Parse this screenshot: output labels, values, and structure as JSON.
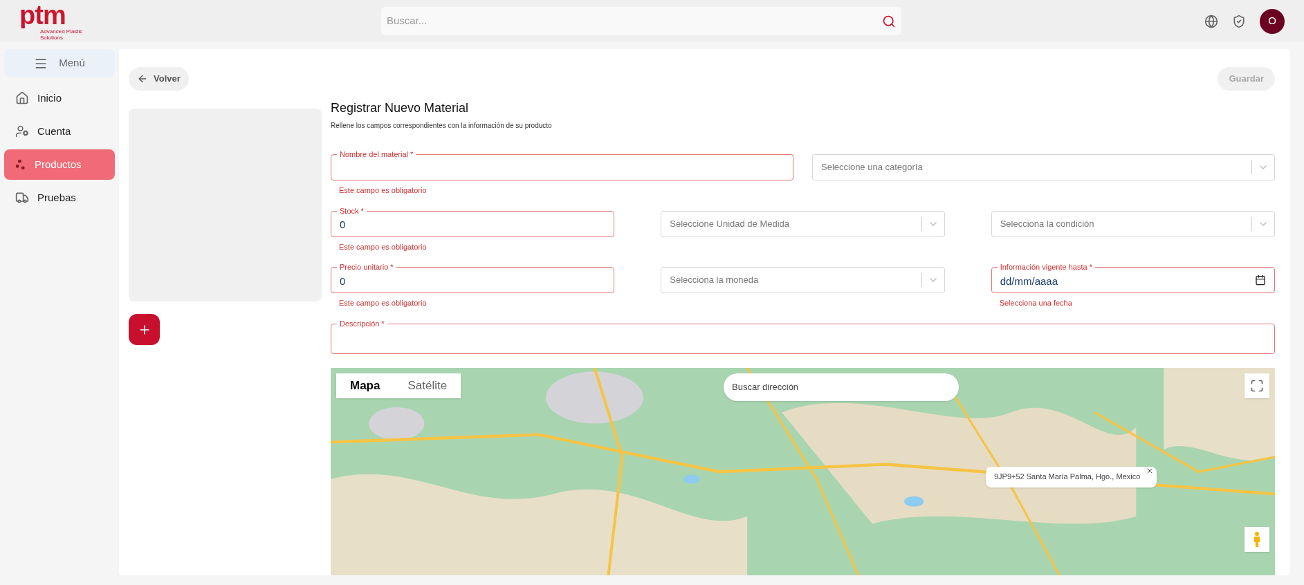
{
  "header": {
    "logo": {
      "brand": "ptm",
      "tagline": "Advanced Plastic Solutions"
    },
    "search": {
      "placeholder": "Buscar..."
    },
    "avatar": "O"
  },
  "sidebar": {
    "menu_button": "Menú",
    "items": [
      {
        "label": "Inicio",
        "selected": false
      },
      {
        "label": "Cuenta",
        "selected": false
      },
      {
        "label": "Productos",
        "selected": true
      },
      {
        "label": "Pruebas",
        "selected": false
      }
    ]
  },
  "toolbar": {
    "back_button": "Volver",
    "save_button": {
      "label": "Guardar",
      "disabled": true
    }
  },
  "form": {
    "title": "Registrar Nuevo Material",
    "subtitle": "Rellene los campos correspondientes con la información de su producto",
    "rows": [
      [
        {
          "kind": "text",
          "label": "Nombre del material *",
          "invalid": true,
          "error": "Este campo es obligatorio"
        },
        {
          "kind": "select",
          "placeholder": "Seleccione una categoría"
        }
      ],
      [
        {
          "kind": "text",
          "label": "Stock *",
          "value": "0",
          "invalid": true,
          "error": "Este campo es obligatorio"
        },
        {
          "kind": "select",
          "placeholder": "Seleccione Unidad de Medida"
        },
        {
          "kind": "select",
          "placeholder": "Selecciona la condición"
        }
      ],
      [
        {
          "kind": "text",
          "label": "Precio unitario *",
          "value": "0",
          "invalid": true,
          "error": "Este campo es obligatorio"
        },
        {
          "kind": "select",
          "placeholder": "Selecciona la moneda"
        },
        {
          "kind": "date",
          "label": "Información vigente hasta *",
          "value": "dd/mm/aaaa",
          "invalid": true,
          "error": "Selecciona una fecha"
        }
      ],
      [
        {
          "kind": "text",
          "label": "Descripción *",
          "invalid": true
        }
      ]
    ]
  },
  "map": {
    "tabs": [
      {
        "label": "Mapa",
        "selected": true
      },
      {
        "label": "Satélite",
        "selected": false
      }
    ],
    "search": {
      "placeholder": "Buscar dirección"
    },
    "popup": "9JP9+52 Santa María Palma, Hgo., Mexico"
  }
}
